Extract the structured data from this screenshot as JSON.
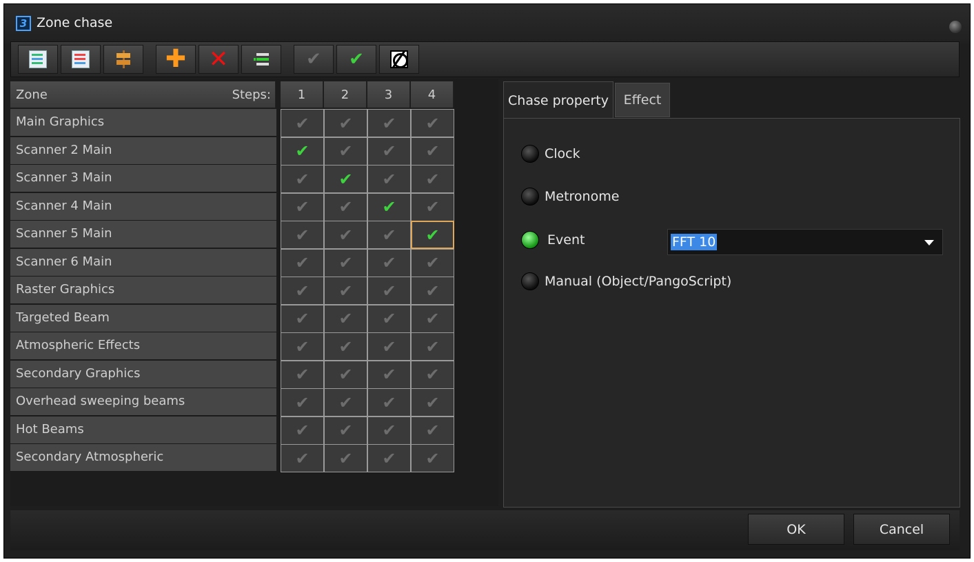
{
  "window": {
    "title": "Zone chase"
  },
  "toolbar": {
    "buttons": [
      {
        "name": "import-icon"
      },
      {
        "name": "export-icon"
      },
      {
        "name": "signpost-icon"
      },
      {
        "name": "add-icon",
        "glyph": "✚"
      },
      {
        "name": "delete-icon",
        "glyph": "✕"
      },
      {
        "name": "list-icon"
      },
      {
        "name": "check-gray-icon",
        "glyph": "✔"
      },
      {
        "name": "check-green-icon",
        "glyph": "✔"
      },
      {
        "name": "null-icon"
      }
    ]
  },
  "grid": {
    "zone_header": "Zone",
    "steps_label": "Steps:",
    "steps": [
      "1",
      "2",
      "3",
      "4"
    ],
    "check_glyph": "✔",
    "rows": [
      {
        "label": "Main Graphics",
        "active": []
      },
      {
        "label": "Scanner 2 Main",
        "active": [
          0
        ]
      },
      {
        "label": "Scanner 3 Main",
        "active": [
          1
        ]
      },
      {
        "label": "Scanner 4 Main",
        "active": [
          2
        ]
      },
      {
        "label": "Scanner 5 Main",
        "active": [
          3
        ]
      },
      {
        "label": "Scanner 6 Main",
        "active": []
      },
      {
        "label": "Raster Graphics",
        "active": []
      },
      {
        "label": "Targeted Beam",
        "active": []
      },
      {
        "label": "Atmospheric Effects",
        "active": []
      },
      {
        "label": "Secondary Graphics",
        "active": []
      },
      {
        "label": "Overhead sweeping beams",
        "active": []
      },
      {
        "label": "Hot Beams",
        "active": []
      },
      {
        "label": "Secondary Atmospheric",
        "active": []
      }
    ],
    "selected": {
      "row": 4,
      "col": 3
    }
  },
  "tabs": {
    "chase_property": "Chase property",
    "effect": "Effect"
  },
  "chase": {
    "options": [
      {
        "label": "Clock",
        "selected": false
      },
      {
        "label": "Metronome",
        "selected": false
      },
      {
        "label": "Event",
        "selected": true
      },
      {
        "label": "Manual (Object/PangoScript)",
        "selected": false
      }
    ],
    "event_value": "FFT 10"
  },
  "footer": {
    "ok": "OK",
    "cancel": "Cancel"
  },
  "colors": {
    "active_check": "#3fd23f",
    "inactive_check": "#6d6d6d",
    "selection": "#e0a85a",
    "highlight": "#3b88e6"
  }
}
